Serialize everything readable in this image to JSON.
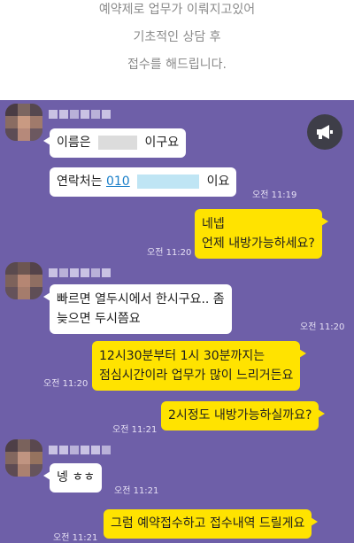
{
  "notice": {
    "line1": "예약제로 업무가 이뤄지고있어",
    "line2": "기초적인 상담 후",
    "line3": "접수를 해드립니다."
  },
  "colors": {
    "chat_bg": "#6e5fa8",
    "outgoing_bubble": "#ffe300",
    "incoming_bubble": "#ffffff",
    "link": "#1a7fc9"
  },
  "icons": {
    "announcement": "megaphone-icon"
  },
  "messages": [
    {
      "side": "in",
      "before": "이름은",
      "after": "이구요"
    },
    {
      "side": "in",
      "before": "연락처는",
      "link": "010",
      "after": "이요",
      "time": "오전 11:19"
    },
    {
      "side": "out",
      "lines": [
        "네넵",
        "언제 내방가능하세요?"
      ],
      "time": "오전 11:20"
    },
    {
      "side": "in",
      "lines": [
        "빠르면 열두시에서 한시구요.. 좀",
        "늦으면 두시쯤요"
      ],
      "time": "오전 11:20"
    },
    {
      "side": "out",
      "lines": [
        "12시30분부터 1시 30분까지는",
        "점심시간이라 업무가 많이 느리거든요"
      ],
      "time": "오전 11:20"
    },
    {
      "side": "out",
      "text": "2시정도 내방가능하실까요?",
      "time": "오전 11:21"
    },
    {
      "side": "in",
      "text": "넹 ㅎㅎ",
      "time": "오전 11:21"
    },
    {
      "side": "out",
      "text": "그럼 예약접수하고 접수내역 드릴게요",
      "time": "오전 11:21"
    }
  ]
}
